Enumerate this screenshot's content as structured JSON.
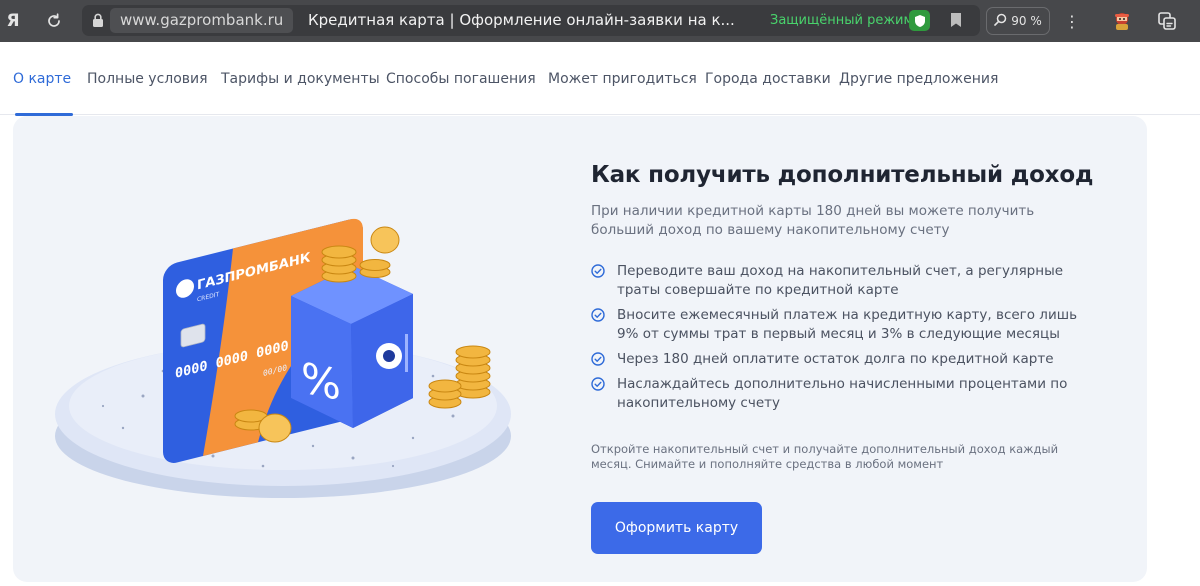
{
  "browser": {
    "logo_letter": "Я",
    "url": "www.gazprombank.ru",
    "title": "Кредитная карта | Оформление онлайн-заявки на к...",
    "secure_mode": "Защищённый режим",
    "zoom": "90 %"
  },
  "tabs": [
    {
      "label": "О карте",
      "active": true
    },
    {
      "label": "Полные условия",
      "active": false
    },
    {
      "label": "Тарифы и документы",
      "active": false
    },
    {
      "label": "Способы погашения",
      "active": false
    },
    {
      "label": "Может пригодиться",
      "active": false
    },
    {
      "label": "Города доставки",
      "active": false
    },
    {
      "label": "Другие предложения",
      "active": false
    }
  ],
  "promo": {
    "heading": "Как получить дополнительный доход",
    "lead": "При наличии кредитной карты 180 дней вы можете получить больший доход по вашему накопительному счету",
    "benefits": [
      "Переводите ваш доход на накопительный счет, а регулярные траты совершайте по кредитной карте",
      "Вносите ежемесячный платеж на кредитную карту, всего лишь 9% от суммы трат в первый месяц и 3% в следующие месяцы",
      "Через 180 дней оплатите остаток долга по кредитной карте",
      "Наслаждайтесь дополнительно начисленными процентами по накопительному счету"
    ],
    "note": "Откройте накопительный счет и получайте дополнительный доход каждый месяц. Снимайте и пополняйте средства в любой момент",
    "cta_label": "Оформить карту"
  },
  "card": {
    "brand": "ГАЗПРОМБАНК",
    "type": "CREDIT",
    "number": "0000 0000 0000 0000",
    "expiry": "00/00"
  },
  "safe_symbol": "%",
  "colors": {
    "accent": "#2f6bd8",
    "button": "#3c6ae8",
    "secure": "#49d36c",
    "card_blue": "#2f5fe0",
    "card_orange": "#f5923a",
    "coin": "#f2b640"
  }
}
